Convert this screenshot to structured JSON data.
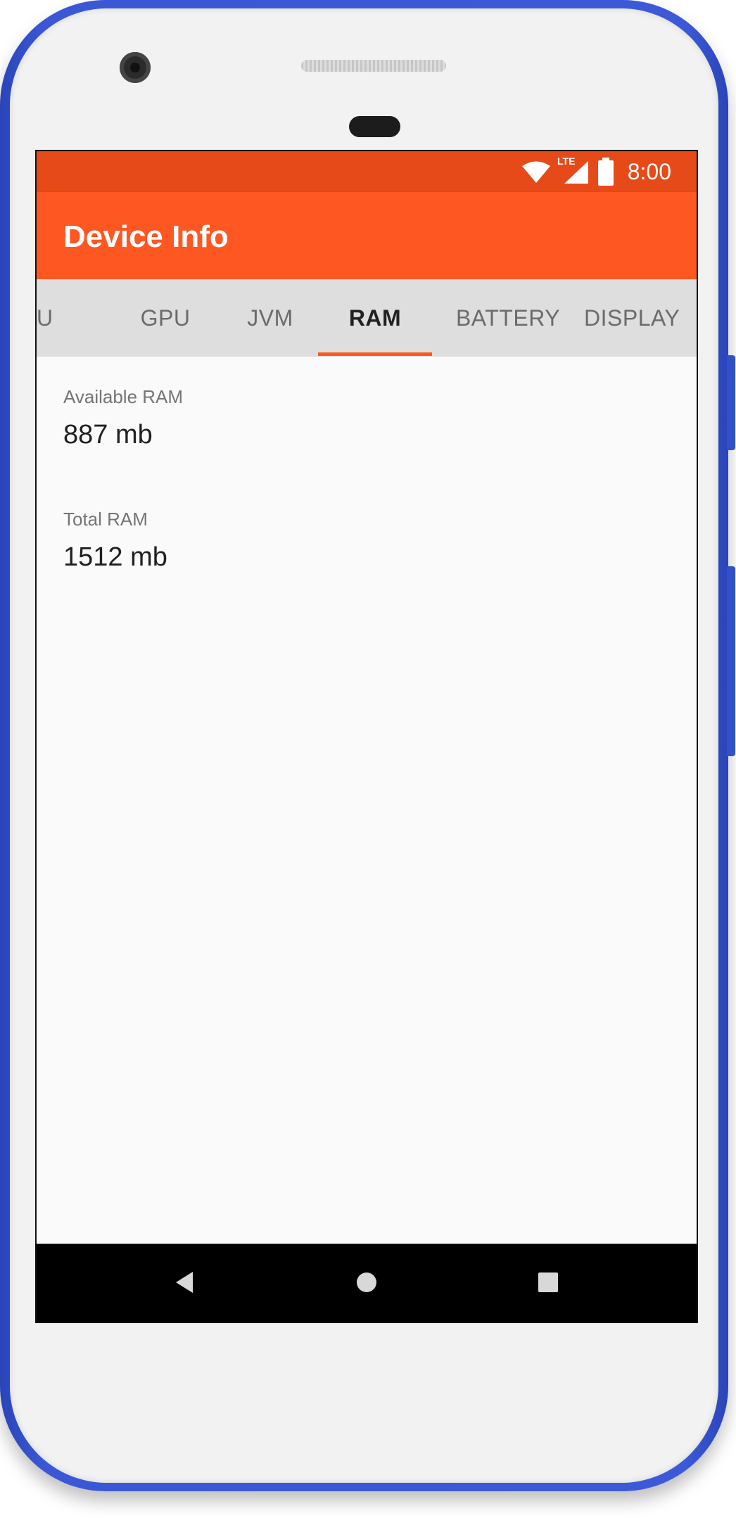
{
  "status_bar": {
    "time": "8:00",
    "icons": [
      "wifi-icon",
      "lte-signal-icon",
      "battery-icon"
    ],
    "lte_label": "LTE"
  },
  "app_bar": {
    "title": "Device Info"
  },
  "tabs": [
    {
      "label": "U",
      "active": false
    },
    {
      "label": "GPU",
      "active": false
    },
    {
      "label": "JVM",
      "active": false
    },
    {
      "label": "RAM",
      "active": true
    },
    {
      "label": "BATTERY",
      "active": false
    },
    {
      "label": "DISPLAY",
      "active": false
    }
  ],
  "ram": {
    "items": [
      {
        "label": "Available RAM",
        "value": "887 mb"
      },
      {
        "label": "Total RAM",
        "value": "1512 mb"
      }
    ]
  },
  "nav_bar": {
    "buttons": [
      "back-icon",
      "home-icon",
      "recents-icon"
    ]
  },
  "colors": {
    "status_bar": "#e64a19",
    "app_bar": "#ff5722",
    "tab_bar": "#dedede",
    "tab_indicator": "#ff5722",
    "phone_frame": "#3c5ad8",
    "nav_bar": "#000000"
  }
}
